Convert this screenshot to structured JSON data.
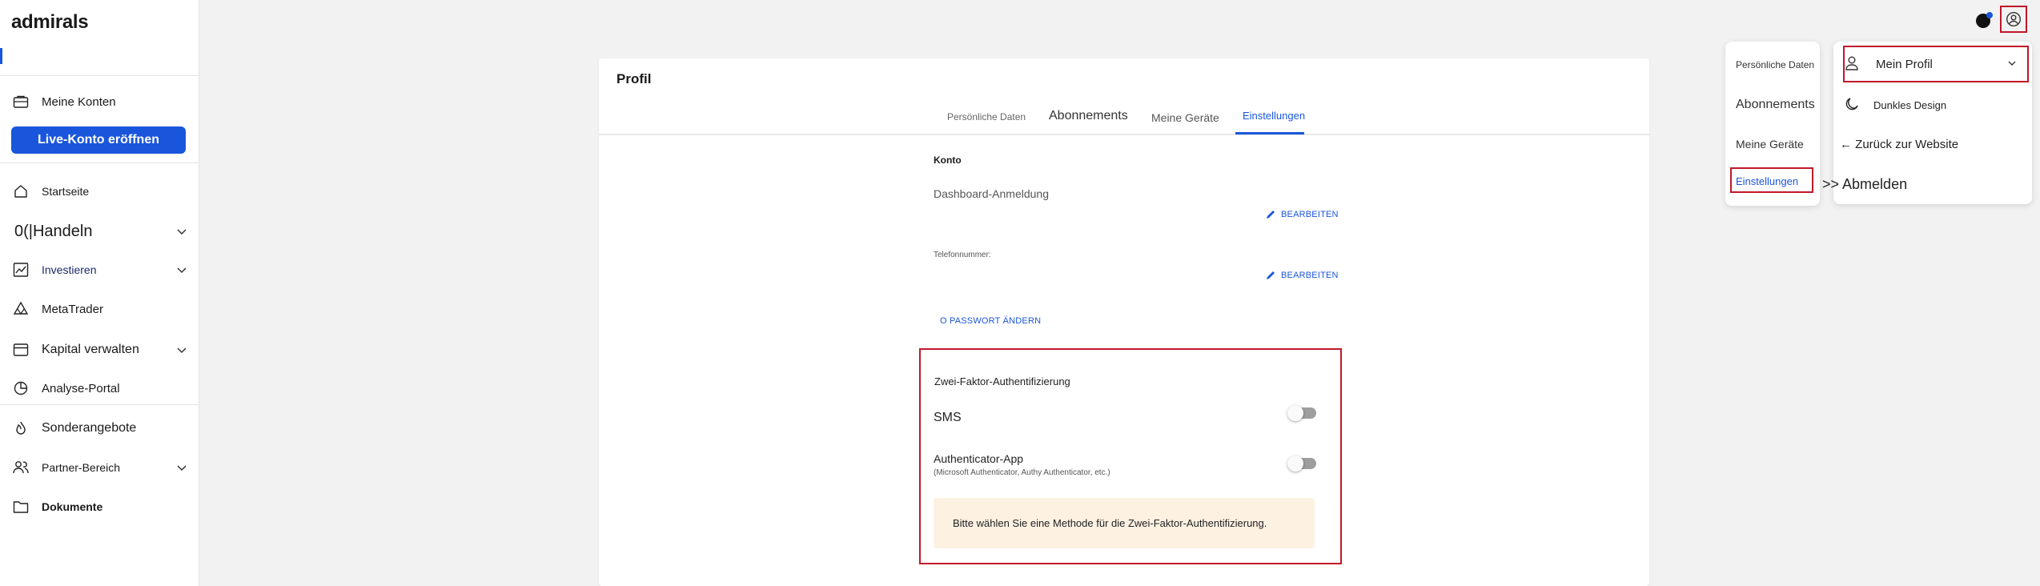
{
  "sidebar": {
    "logo": "admirals",
    "nav_top": {
      "label": "Meine Konten",
      "icon": "wallet-icon"
    },
    "live_button": "Live-Konto eröffnen",
    "items": [
      {
        "label": "Startseite",
        "icon": "home-icon",
        "chevron": false
      },
      {
        "label": "Handeln",
        "prefix": "0(|",
        "chevron": true
      },
      {
        "label": "Investieren",
        "icon": "chart-line-icon",
        "chevron": true,
        "active": true
      },
      {
        "label": "MetaTrader",
        "icon": "metatrader-icon",
        "chevron": false
      },
      {
        "label": "Kapital verwalten",
        "icon": "card-icon",
        "chevron": true
      },
      {
        "label": "Analyse-Portal",
        "icon": "pie-chart-icon",
        "chevron": false
      },
      {
        "label": "Sonderangebote",
        "icon": "flame-icon",
        "chevron": false
      },
      {
        "label": "Partner-Bereich",
        "icon": "partners-icon",
        "chevron": true
      },
      {
        "label": "Dokumente",
        "icon": "folder-icon",
        "chevron": false
      }
    ]
  },
  "main": {
    "title": "Profil",
    "tabs": [
      "Persönliche Daten",
      "Abonnements",
      "Meine Geräte",
      "Einstellungen"
    ],
    "active_tab": "Einstellungen",
    "konto": {
      "heading": "Konto",
      "dashboard_label": "Dashboard-Anmeldung",
      "edit_label": "BEARBEITEN",
      "phone_label": "Telefonnummer:",
      "password_label": "O PASSWORT ÄNDERN"
    },
    "twofa": {
      "heading": "Zwei-Faktor-Authentifizierung",
      "sms_label": "SMS",
      "app_label": "Authenticator-App",
      "app_sub": "(Microsoft Authenticator, Authy Authenticator, etc.)",
      "info": "Bitte wählen Sie eine Methode für die Zwei-Faktor-Authentifizierung."
    }
  },
  "dropdown_tabs": [
    "Persönliche Daten",
    "Abonnements",
    "Meine Geräte",
    "Einstellungen"
  ],
  "profile_menu": {
    "header": "Mein Profil",
    "dark_mode": "Dunkles Design",
    "back": "← Zurück zur Website",
    "logout": ">> Abmelden"
  },
  "colors": {
    "accent": "#1a56db",
    "highlight_border": "#c0182a",
    "info_bg": "#fdf1e2"
  }
}
